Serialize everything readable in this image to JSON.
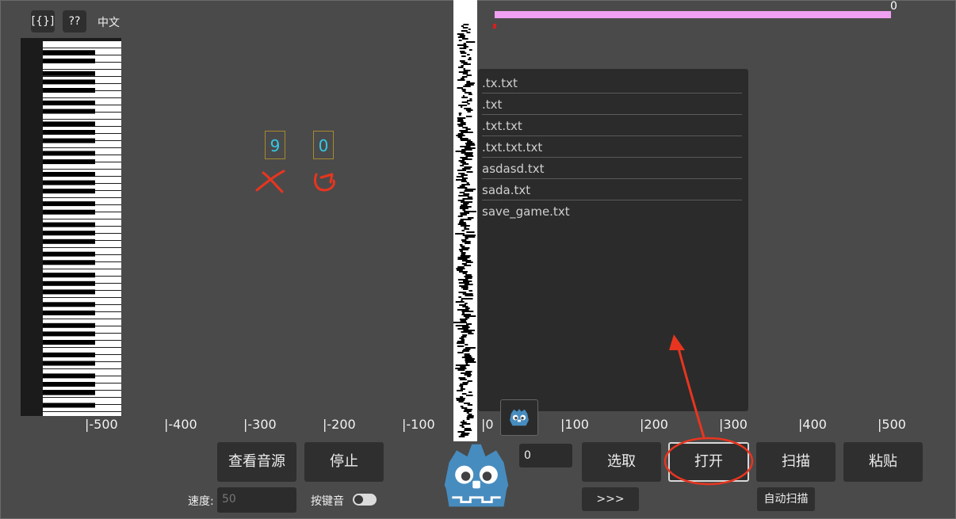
{
  "toolbar": {
    "json_button": "[{}]",
    "help_button": "??",
    "language": "中文"
  },
  "counters": {
    "left": "9",
    "right": "0"
  },
  "progress": {
    "value_text": "0",
    "fraction": 0.0
  },
  "files": [
    ".tx.txt",
    ".txt",
    ".txt.txt",
    ".txt.txt.txt",
    "asdasd.txt",
    "sada.txt",
    "save_game.txt"
  ],
  "ruler": [
    "|-500",
    "|-400",
    "|-300",
    "|-200",
    "|-100",
    "|0",
    "|100",
    "|200",
    "|300",
    "|400",
    "|500"
  ],
  "buttons": {
    "view_sources": "查看音源",
    "stop": "停止",
    "select": "选取",
    "open": "打开",
    "scan": "扫描",
    "paste": "粘贴",
    "more": ">>>",
    "auto_scan": "自动扫描"
  },
  "speed": {
    "label": "速度:",
    "placeholder": "50"
  },
  "key_sound": {
    "label": "按键音",
    "enabled": true
  },
  "number_input": {
    "value": "0"
  },
  "colors": {
    "accent_cyan": "#34c8e6",
    "annotation_red": "#e8351f",
    "progress_pink": "#efa0f0",
    "counter_border": "#a78a2e"
  },
  "icons": [
    "godot-logo-icon",
    "undo-icon",
    "close-icon"
  ]
}
